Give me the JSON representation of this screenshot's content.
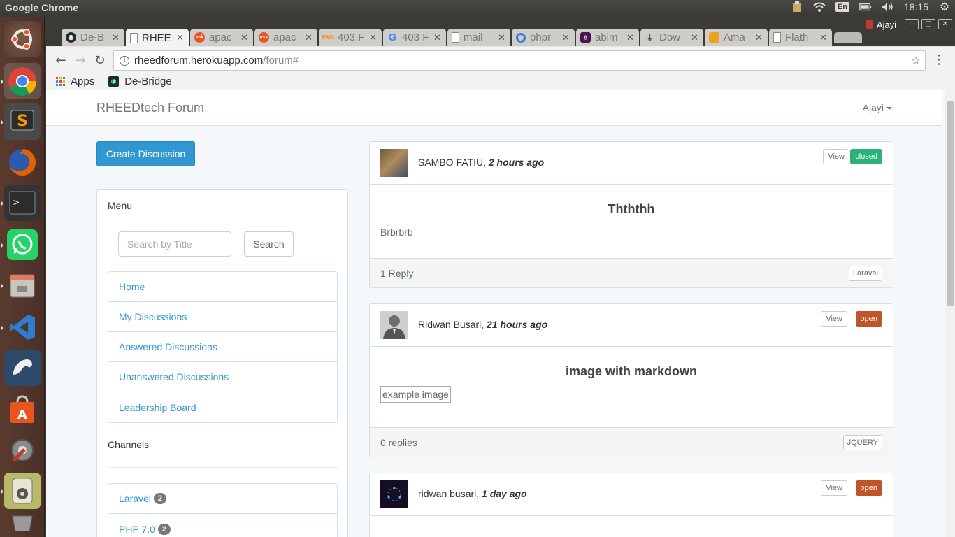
{
  "os": {
    "app_title": "Google Chrome",
    "keyboard_layout": "En",
    "clock": "18:15"
  },
  "browser": {
    "tabs": [
      {
        "label": "De-B",
        "favicon": "debridge-icon",
        "color": "#1f2d2b"
      },
      {
        "label": "RHEE",
        "favicon": "page-icon",
        "color": "#ffffff",
        "active": true
      },
      {
        "label": "apac",
        "favicon": "askubuntu-icon",
        "color": "#e95420"
      },
      {
        "label": "apac",
        "favicon": "askubuntu-icon",
        "color": "#e95420"
      },
      {
        "label": "403 F",
        "favicon": "phpmyadmin-icon",
        "color": "#f29111"
      },
      {
        "label": "403 F",
        "favicon": "google-icon",
        "color": "#4285f4"
      },
      {
        "label": "mail",
        "favicon": "page-icon",
        "color": "#ffffff"
      },
      {
        "label": "phpr",
        "favicon": "phpunit-icon",
        "color": "#3a7bd5"
      },
      {
        "label": "abim",
        "favicon": "slack-icon",
        "color": "#4a154b"
      },
      {
        "label": "Dow",
        "favicon": "download-icon",
        "color": "#555555"
      },
      {
        "label": "Ama",
        "favicon": "amazon-icon",
        "color": "#f0a020"
      },
      {
        "label": "Flath",
        "favicon": "page-icon",
        "color": "#ffffff"
      }
    ],
    "profile_name": "Ajayi",
    "url_host": "rheedforum.herokuapp.com",
    "url_path": "/forum#",
    "bookmarks": [
      {
        "label": "Apps",
        "icon": "apps-grid-icon"
      },
      {
        "label": "De-Bridge",
        "icon": "debridge-icon"
      }
    ]
  },
  "site": {
    "brand": "RHEEDtech Forum",
    "user": "Ajayi",
    "create_button": "Create Discussion",
    "menu_heading": "Menu",
    "search_placeholder": "Search by Title",
    "search_button": "Search",
    "menu_items": [
      "Home",
      "My Discussions",
      "Answered Discussions",
      "Unanswered Discussions",
      "Leadership Board"
    ],
    "channels_heading": "Channels",
    "channels": [
      {
        "name": "Laravel",
        "count": "2"
      },
      {
        "name": "PHP 7.0",
        "count": "2"
      }
    ]
  },
  "discussions": [
    {
      "author": "SAMBO FATIU,",
      "time": "2 hours ago",
      "view_label": "View",
      "status": "closed",
      "status_color": "#2ab27b",
      "title": "Thththh",
      "body": "Brbrbrb",
      "replies": "1 Reply",
      "channel": "Laravel"
    },
    {
      "author": "Ridwan Busari,",
      "time": "21 hours ago",
      "view_label": "View",
      "status": "open",
      "status_color": "#bf5329",
      "title": "image with markdown",
      "body_image_alt": "example image",
      "replies": "0 replies",
      "channel": "JQUERY"
    },
    {
      "author": "ridwan busari,",
      "time": "1 day ago",
      "view_label": "View",
      "status": "open",
      "status_color": "#bf5329"
    }
  ]
}
